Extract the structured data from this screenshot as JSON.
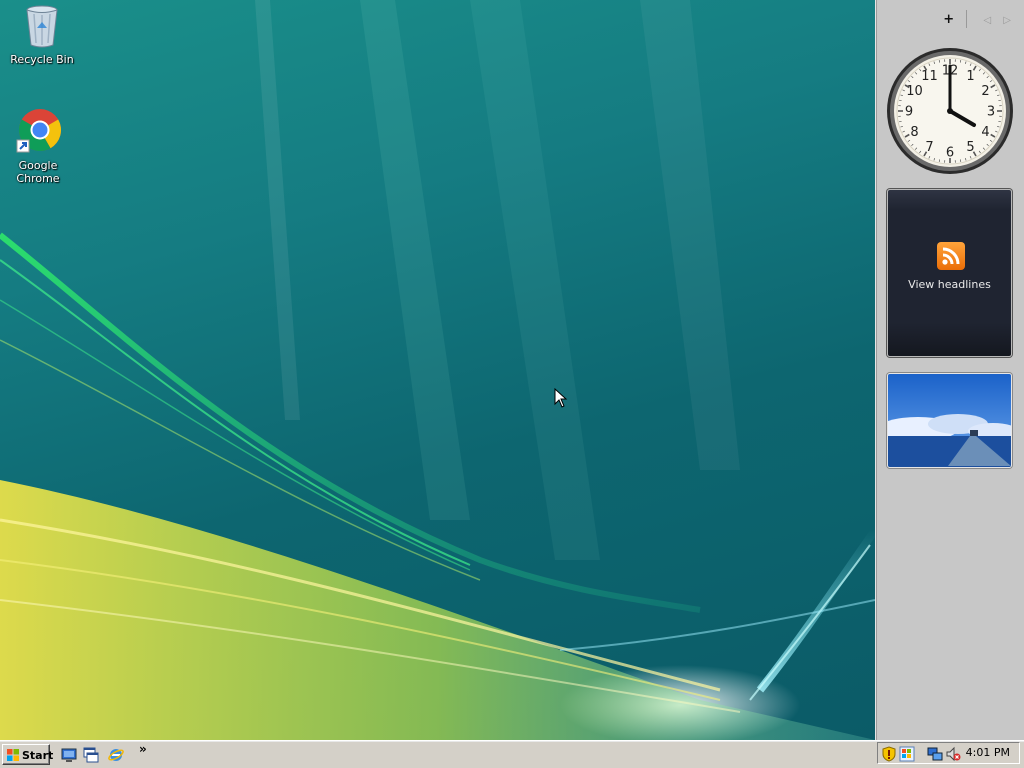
{
  "desktop": {
    "icons": [
      {
        "label": "Recycle Bin",
        "icon": "recycle-bin-icon"
      },
      {
        "label": "Google Chrome",
        "icon": "chrome-icon"
      }
    ]
  },
  "sidebar": {
    "controls": [
      "+",
      "◁",
      "▷"
    ],
    "clock": {
      "time_shown": "4:00",
      "numerals": [
        "12",
        "1",
        "2",
        "3",
        "4",
        "5",
        "6",
        "7",
        "8",
        "9",
        "10",
        "11"
      ]
    },
    "feed_headlines": {
      "label": "View headlines",
      "icon": "rss-icon"
    },
    "slideshow": {
      "icon": "landscape-photo"
    }
  },
  "taskbar": {
    "start_label": "Start",
    "quick_launch": [
      "show-desktop-icon",
      "window-switcher-icon",
      "internet-explorer-icon"
    ],
    "overflow": "»",
    "tray_icons": [
      "security-shield-icon",
      "windows-update-icon",
      "network-icon",
      "volume-muted-icon"
    ],
    "time": "4:01 PM"
  },
  "colors": {
    "taskbar": "#d4d0c8",
    "sidebar": "#c7c7c7",
    "wallpaper_teal": "#0d6670",
    "wallpaper_green": "#2ee86a",
    "wallpaper_yellow": "#e8e04a",
    "rss_orange": "#f28a1e"
  }
}
